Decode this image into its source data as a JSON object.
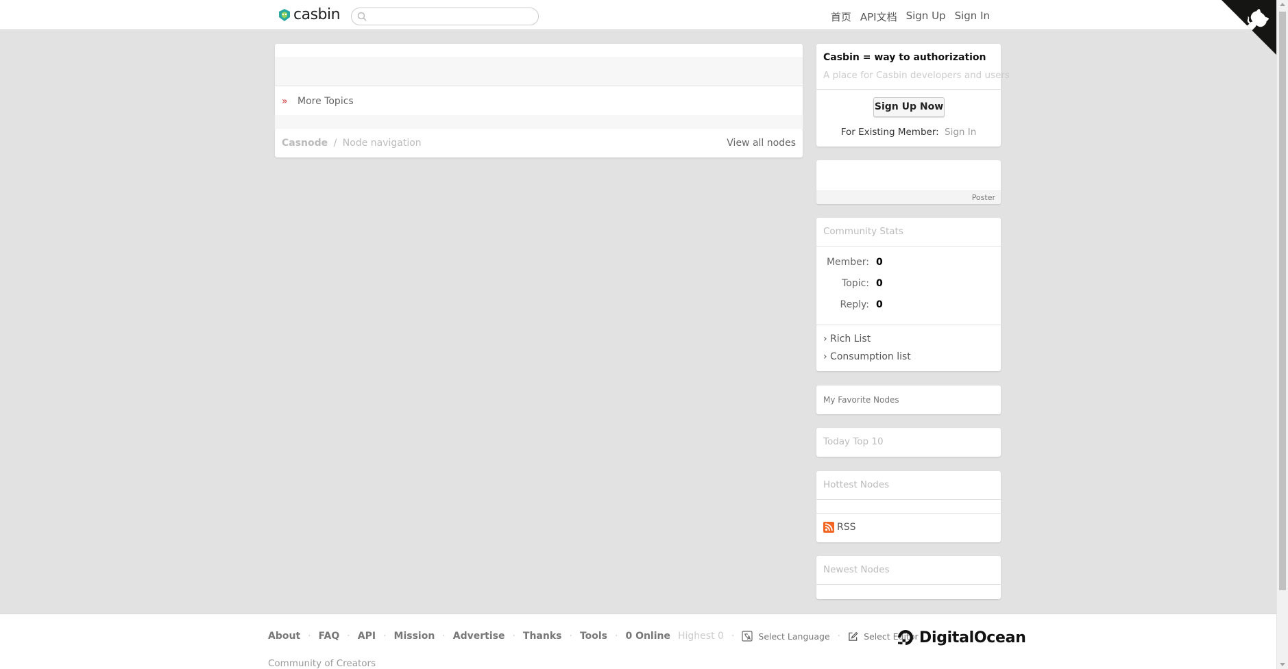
{
  "header": {
    "logo_text": "casbin",
    "search_placeholder": "",
    "nav": [
      "首页",
      "API文档",
      "Sign Up",
      "Sign In"
    ]
  },
  "main": {
    "more_topics_marker": "»",
    "more_topics": "More Topics",
    "breadcrumb_home": "Casnode",
    "breadcrumb_sep": "/",
    "breadcrumb_current": "Node navigation",
    "view_all_nodes": "View all nodes"
  },
  "sidebar": {
    "tagline": "Casbin = way to authorization",
    "subtitle": "A place for Casbin developers and users",
    "signup_now": "Sign Up Now",
    "existing_member": "For Existing Member:",
    "sign_in": "Sign In",
    "poster": "Poster",
    "community_stats": "Community Stats",
    "stats": [
      {
        "label": "Member:",
        "value": "0"
      },
      {
        "label": "Topic:",
        "value": "0"
      },
      {
        "label": "Reply:",
        "value": "0"
      }
    ],
    "rich_list": "› Rich List",
    "consumption_list": "› Consumption list",
    "favorite_nodes": "My Favorite Nodes",
    "today_top": "Today Top 10",
    "hottest_nodes": "Hottest Nodes",
    "rss": "RSS",
    "newest_nodes": "Newest Nodes"
  },
  "footer": {
    "links": [
      "About",
      "FAQ",
      "API",
      "Mission",
      "Advertise",
      "Thanks",
      "Tools"
    ],
    "online": "0 Online",
    "highest": "Highest 0",
    "select_language": "Select Language",
    "select_editor": "Select Editor",
    "community": "Community of Creators",
    "sponsor": "DigitalOcean"
  },
  "colors": {
    "background": "#e2e2e2",
    "rss": "#f26522",
    "accent_red": "#cc3333"
  }
}
